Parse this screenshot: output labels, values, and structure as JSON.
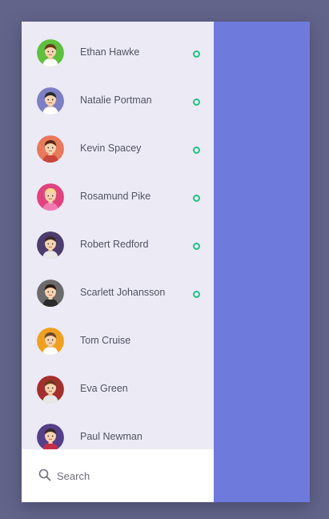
{
  "colors": {
    "background": "#626489",
    "sidebar": "#ebeaf5",
    "content_panel": "#6e7bdc",
    "online_status": "#20c183"
  },
  "contacts": [
    {
      "name": "Ethan Hawke",
      "online": true,
      "avatar_bg": "#5fbf3f"
    },
    {
      "name": "Natalie Portman",
      "online": true,
      "avatar_bg": "#7d7fc4"
    },
    {
      "name": "Kevin Spacey",
      "online": true,
      "avatar_bg": "#e8795a"
    },
    {
      "name": "Rosamund Pike",
      "online": true,
      "avatar_bg": "#e0437e"
    },
    {
      "name": "Robert Redford",
      "online": true,
      "avatar_bg": "#4b3d6e"
    },
    {
      "name": "Scarlett Johansson",
      "online": true,
      "avatar_bg": "#6b6b6b"
    },
    {
      "name": "Tom Cruise",
      "online": false,
      "avatar_bg": "#f0a020"
    },
    {
      "name": "Eva Green",
      "online": false,
      "avatar_bg": "#a3302f"
    },
    {
      "name": "Paul Newman",
      "online": false,
      "avatar_bg": "#553f8a"
    }
  ],
  "search": {
    "placeholder": "Search",
    "icon": "search-icon"
  }
}
